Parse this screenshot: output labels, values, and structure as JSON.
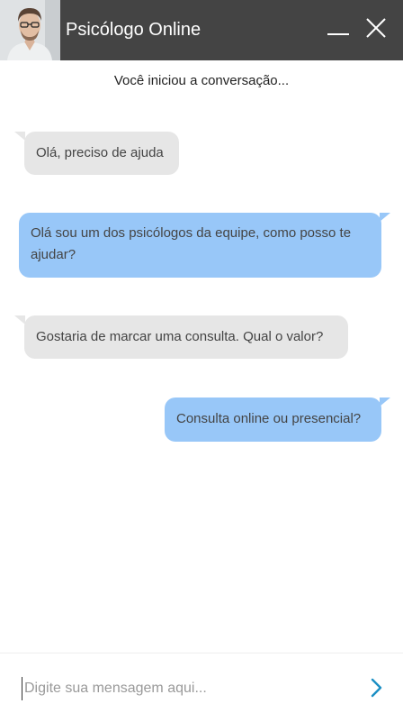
{
  "header": {
    "title": "Psicólogo Online",
    "minimize_icon": "minimize-icon",
    "close_icon": "close-icon"
  },
  "system_message": "Você iniciou a conversação...",
  "messages": [
    {
      "sender": "user",
      "text": "Olá, preciso de ajuda"
    },
    {
      "sender": "psychologist",
      "text": "Olá sou um dos psicólogos da equipe, como posso te ajudar?"
    },
    {
      "sender": "user",
      "text": "Gostaria de marcar uma consulta. Qual o valor?"
    },
    {
      "sender": "psychologist",
      "text": "Consulta online ou presencial?"
    }
  ],
  "composer": {
    "placeholder": "Digite sua mensagem aqui...",
    "value": "",
    "send_icon": "chevron-right-icon"
  },
  "colors": {
    "header_bg": "#444444",
    "incoming_bubble": "#e6e6e6",
    "outgoing_bubble": "#98c7f8",
    "send_icon": "#1b8fc4"
  }
}
